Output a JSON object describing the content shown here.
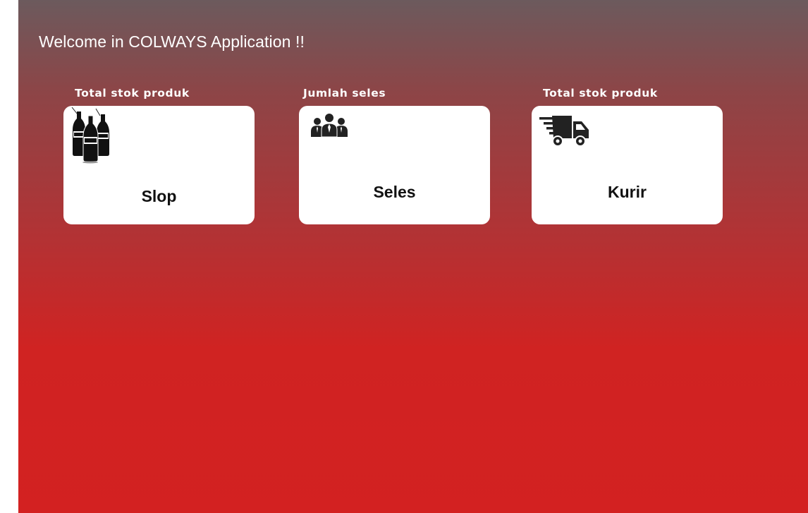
{
  "header": {
    "welcome_text": "Welcome in COLWAYS Application !!"
  },
  "cards": [
    {
      "label": "Total stok produk",
      "title": "Slop",
      "icon": "cola-bottles-icon"
    },
    {
      "label": "Jumlah seles",
      "title": "Seles",
      "icon": "team-icon"
    },
    {
      "label": "Total stok produk",
      "title": "Kurir",
      "icon": "delivery-truck-icon"
    }
  ],
  "colors": {
    "gradient_top": "#6c5a5d",
    "gradient_bottom": "#d32121",
    "card_background": "#ffffff",
    "text_light": "#ffffff",
    "text_dark": "#111111"
  }
}
